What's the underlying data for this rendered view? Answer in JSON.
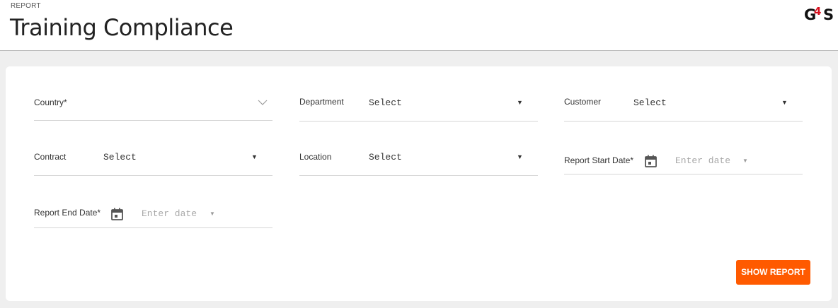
{
  "header": {
    "breadcrumb": "REPORT",
    "title": "Training Compliance",
    "logo_text": "G4S"
  },
  "filters": {
    "country": {
      "label": "Country*",
      "value": "",
      "icon": "chevron-down-icon"
    },
    "department": {
      "label": "Department",
      "value": "Select",
      "icon": "caret-down-icon"
    },
    "customer": {
      "label": "Customer",
      "value": "Select",
      "icon": "caret-down-icon"
    },
    "contract": {
      "label": "Contract",
      "value": "Select",
      "icon": "caret-down-icon"
    },
    "location": {
      "label": "Location",
      "value": "Select",
      "icon": "caret-down-icon"
    },
    "start_date": {
      "label": "Report Start Date*",
      "placeholder": "Enter date",
      "icon": "calendar-icon"
    },
    "end_date": {
      "label": "Report End Date*",
      "placeholder": "Enter date",
      "icon": "calendar-icon"
    }
  },
  "actions": {
    "show_report": "SHOW REPORT"
  },
  "colors": {
    "accent": "#ff5a00",
    "background": "#efefef",
    "card": "#ffffff"
  }
}
